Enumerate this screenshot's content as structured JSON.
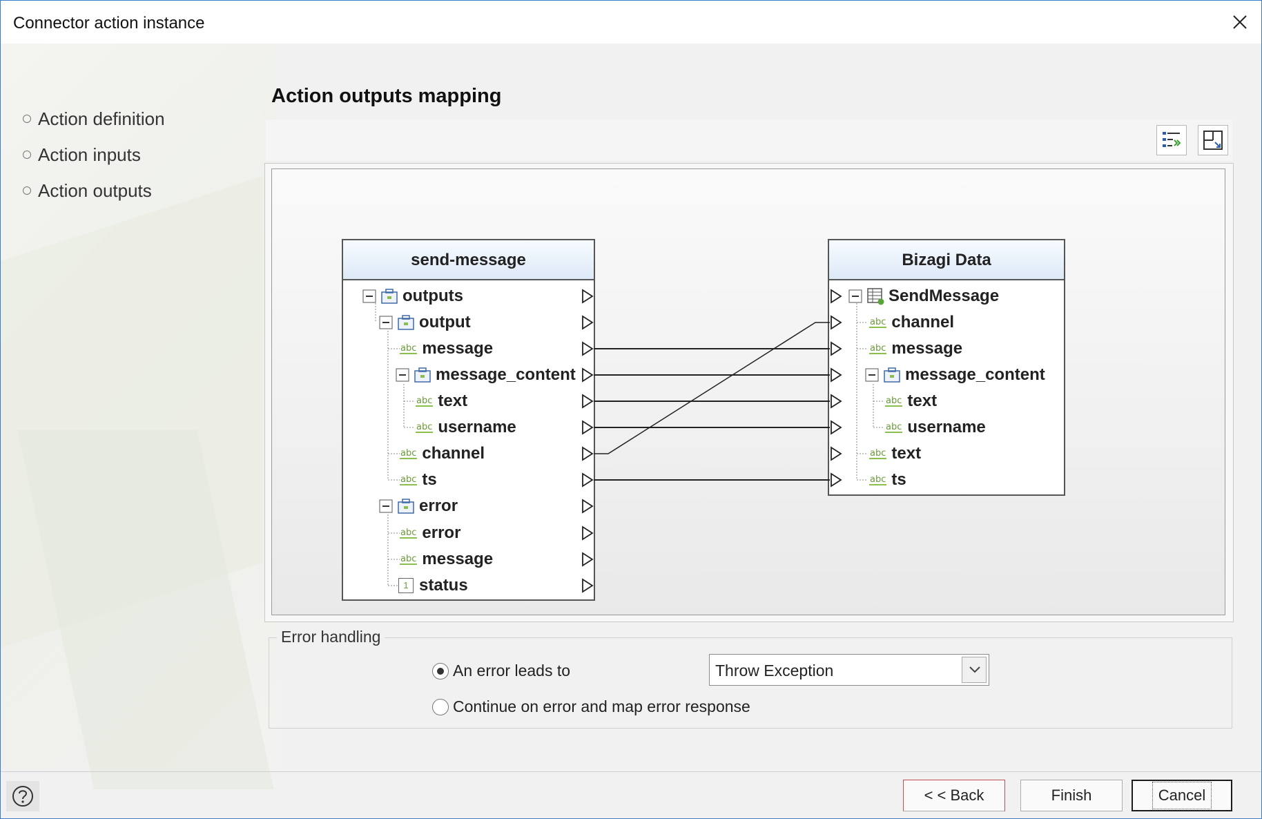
{
  "window": {
    "title": "Connector action instance"
  },
  "nav": {
    "items": [
      {
        "label": "Action definition"
      },
      {
        "label": "Action inputs"
      },
      {
        "label": "Action outputs"
      }
    ]
  },
  "main": {
    "title": "Action outputs mapping"
  },
  "toolbar": {
    "buttons": [
      {
        "icon": "auto-map-icon"
      },
      {
        "icon": "fit-view-icon"
      }
    ]
  },
  "mapper": {
    "source": {
      "title": "send-message",
      "rows": [
        {
          "label": "outputs",
          "type": "object"
        },
        {
          "label": "output",
          "type": "object"
        },
        {
          "label": "message",
          "type": "string",
          "type_badge": "abc"
        },
        {
          "label": "message_content",
          "type": "object"
        },
        {
          "label": "text",
          "type": "string",
          "type_badge": "abc"
        },
        {
          "label": "username",
          "type": "string",
          "type_badge": "abc"
        },
        {
          "label": "channel",
          "type": "string",
          "type_badge": "abc"
        },
        {
          "label": "ts",
          "type": "string",
          "type_badge": "abc"
        },
        {
          "label": "error",
          "type": "object"
        },
        {
          "label": "error",
          "type": "string",
          "type_badge": "abc"
        },
        {
          "label": "message",
          "type": "string",
          "type_badge": "abc"
        },
        {
          "label": "status",
          "type": "integer",
          "type_badge": "1"
        }
      ]
    },
    "target": {
      "title": "Bizagi Data",
      "rows": [
        {
          "label": "SendMessage",
          "type": "entity"
        },
        {
          "label": "channel",
          "type": "string",
          "type_badge": "abc"
        },
        {
          "label": "message",
          "type": "string",
          "type_badge": "abc"
        },
        {
          "label": "message_content",
          "type": "object"
        },
        {
          "label": "text",
          "type": "string",
          "type_badge": "abc"
        },
        {
          "label": "username",
          "type": "string",
          "type_badge": "abc"
        },
        {
          "label": "text",
          "type": "string",
          "type_badge": "abc"
        },
        {
          "label": "ts",
          "type": "string",
          "type_badge": "abc"
        }
      ]
    }
  },
  "error_handling": {
    "legend": "Error handling",
    "option_error": "An error leads to",
    "option_continue": "Continue on error and map error response",
    "selected_option": "An error leads to",
    "dropdown_value": "Throw Exception"
  },
  "footer": {
    "help_icon": "help-icon",
    "back_label": "< < Back",
    "finish_label": "Finish",
    "cancel_label": "Cancel"
  }
}
